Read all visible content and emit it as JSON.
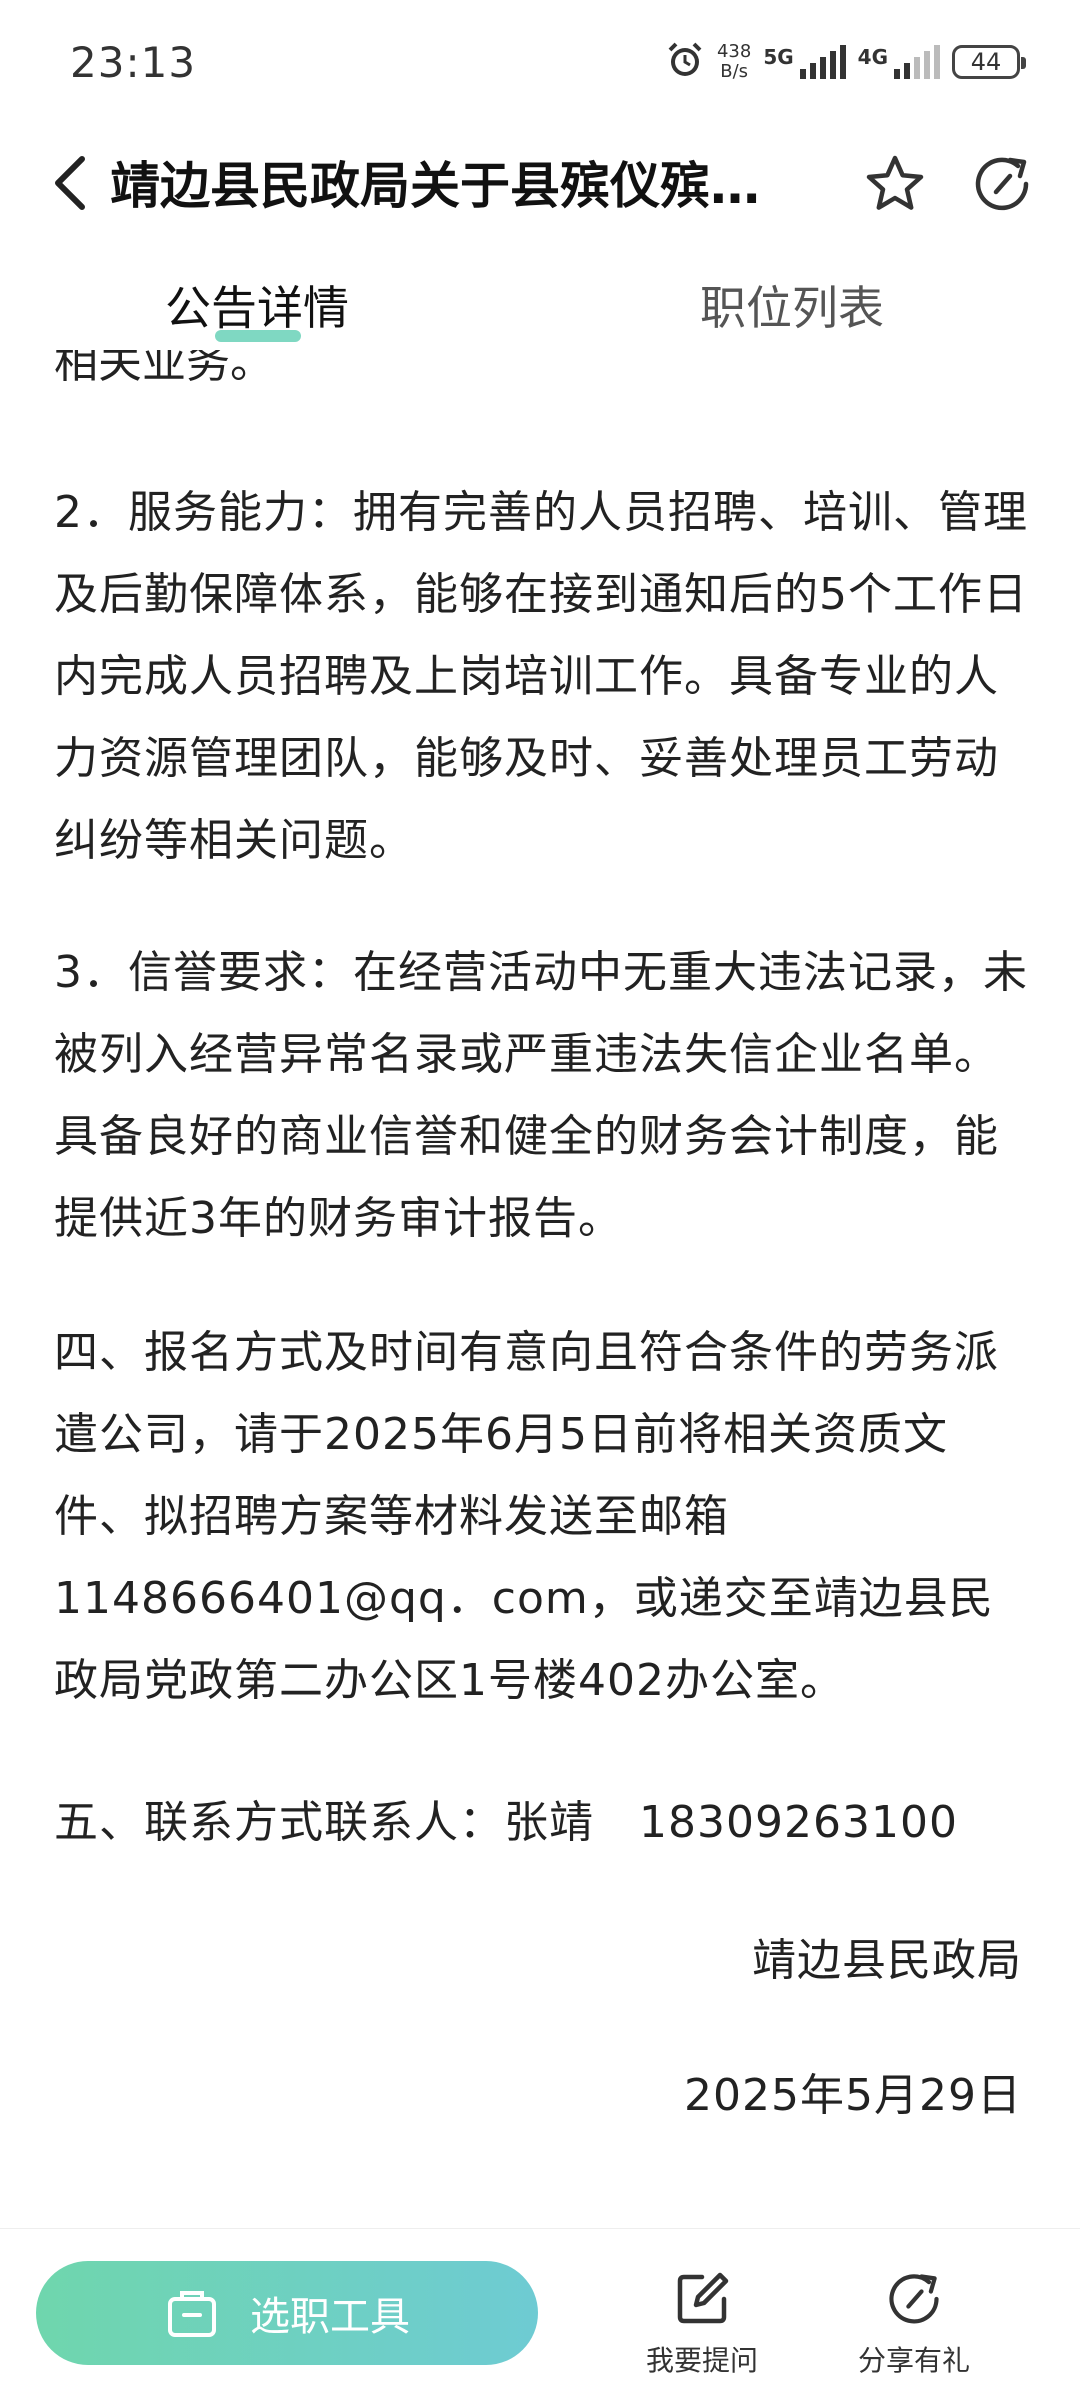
{
  "status": {
    "time": "23:13",
    "net_speed_value": "438",
    "net_speed_unit": "B/s",
    "signal1": "5G",
    "signal2": "4G",
    "battery": "44"
  },
  "header": {
    "title": "靖边县民政局关于县殡仪殡…"
  },
  "tabs": [
    {
      "label": "公告详情"
    },
    {
      "label": "职位列表"
    }
  ],
  "content": {
    "cut_line": "相关业务。",
    "paragraphs": [
      "2．服务能力：拥有完善的人员招聘、培训、管理及后勤保障体系，能够在接到通知后的5个工作日内完成人员招聘及上岗培训工作。具备专业的人力资源管理团队，能够及时、妥善处理员工劳动纠纷等相关问题。",
      "3．信誉要求：在经营活动中无重大违法记录，未被列入经营异常名录或严重违法失信企业名单。具备良好的商业信誉和健全的财务会计制度，能提供近3年的财务审计报告。",
      "四、报名方式及时间有意向且符合条件的劳务派遣公司，请于2025年6月5日前将相关资质文件、拟招聘方案等材料发送至邮箱1148666401@qq．com，或递交至靖边县民政局党政第二办公区1号楼402办公室。",
      "五、联系方式联系人：张靖　18309263100"
    ],
    "signature": "靖边县民政局",
    "date": "2025年5月29日"
  },
  "bottom_bar": {
    "tool_button": "选职工具",
    "ask_label": "我要提问",
    "share_label": "分享有礼"
  },
  "colors": {
    "accent": "#7fd8c2",
    "button_gradient_start": "#6fd6ad",
    "button_gradient_end": "#6ecbd3"
  }
}
